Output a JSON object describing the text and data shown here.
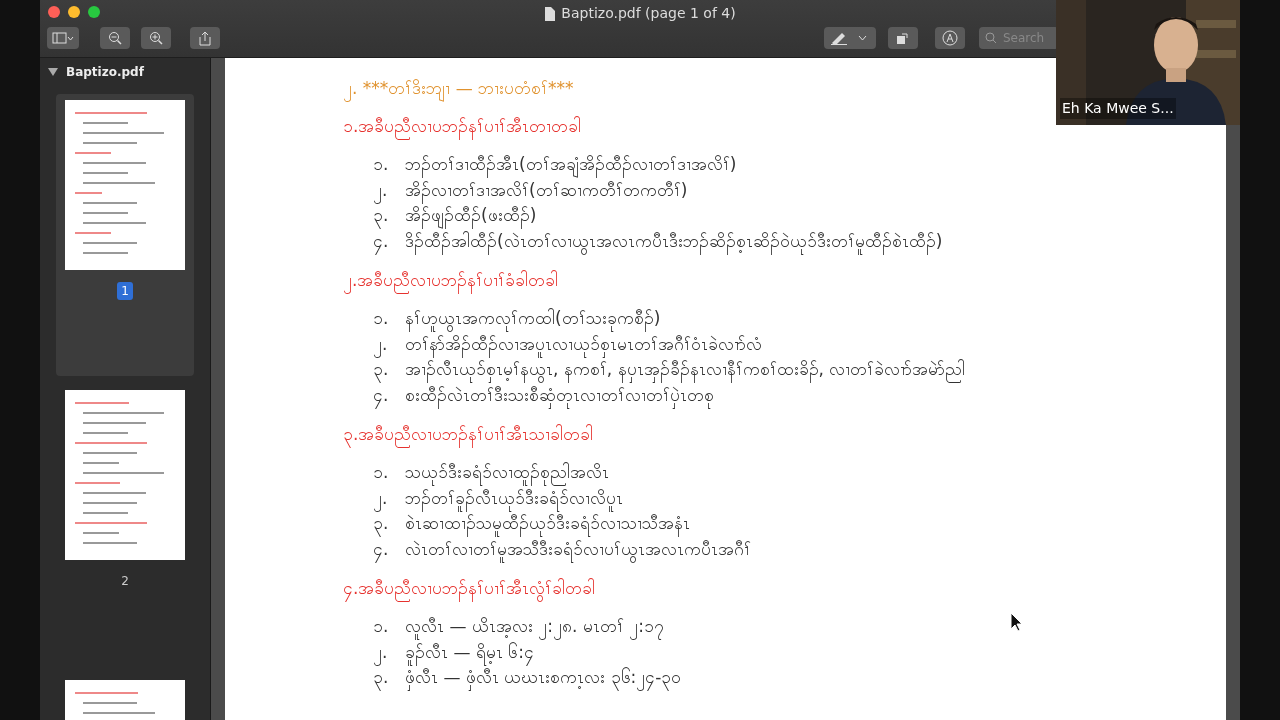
{
  "window": {
    "title": "Baptizo.pdf (page 1 of 4)"
  },
  "toolbar": {
    "search": {
      "placeholder": "Search"
    }
  },
  "sidebar": {
    "file": "Baptizo.pdf",
    "expanded": true,
    "pages": [
      {
        "label": "1",
        "selected": true
      },
      {
        "label": "2",
        "selected": false
      },
      {
        "selected": false
      }
    ]
  },
  "document": {
    "title": "၂. ***တၢ်ဒိးဘျၢ — ဘၢးပတံစၢ်***",
    "sections": [
      {
        "heading": "၁.အခီပညီလၢပဘၣ်နၢ်ပၢၢ်အီၤတၢတခါ",
        "items": [
          {
            "number": "၁.",
            "text": "ဘၣ်တၢ်ဒၢထီၣ်အီၤ(တၢ်အချံအိၣ်ထီၣ်လၢတၢ်ဒၢအလိၢ်)"
          },
          {
            "number": "၂.",
            "text": "အိၣ်လၢတၢ်ဒၢအလိၢ်(တၢ်ဆၢကတီၢ်တကတီၢ်)"
          },
          {
            "number": "၃.",
            "text": "အိၣ်ဖျၣ်ထီၣ်(ဖးထီၣ်)"
          },
          {
            "number": "၄.",
            "text": "ဒိၣ်ထီၣ်အါထီၣ်(လဲၤတၢ်လၢယွၤအလၤကပီၤဒီးဘၣ်ဆိၣ်စ့ၤဆိၣ်ဝဲယုၥ်ဒီးတၢ်မူထီၣ်စဲၤထီၣ်)"
          }
        ]
      },
      {
        "heading": "၂.အခီပညီလၢပဘၣ်နၢ်ပၢၢ်ခံခါတခါ",
        "items": [
          {
            "number": "၁.",
            "text": "နၢ်ဟူယွၤအကလုၢ်ကထါ(တၢ်သးခုကစီၣ်)"
          },
          {
            "number": "၂.",
            "text": "တၢ်နာ်အိၣ်ထီၣ်လၢအပူၤလၢယုၥ်စှၤမၤတၢ်အဂီၢ်ဝံၤခဲလၢာ်လံ"
          },
          {
            "number": "၃.",
            "text": "အၢၣ်လီၤယုၥ်စှၤမ့ၢ်နယွၤ, နကစၢ်, နပှၤအှၣ်ခီၣ်နၤလၢနီၢ်ကစၢ်ထးခိၣ်, လၢတၢ်ခဲလၢာ်အမဲာ်ညါ"
          },
          {
            "number": "၄.",
            "text": "စးထီၣ်လဲၤတၢ်ဒီးသးစီဆှံတုၤလၢတၢ်လၢတၢ်ပှဲၤတစု"
          }
        ]
      },
      {
        "heading": "၃.အခီပညီလၢပဘၣ်နၢ်ပၢၢ်အီၤသၢခါတခါ",
        "items": [
          {
            "number": "၁.",
            "text": "သယုၥ်ဒီးခရံၥ်လၢထူၣ်စုညါအလိၤ"
          },
          {
            "number": "၂.",
            "text": "ဘၣ်တၢ်ခူၣ်လီၤယုၥ်ဒီးခရံၥ်လၢလိပူၤ"
          },
          {
            "number": "၃.",
            "text": "စဲၤဆၢထၢၣ်သမူထီၣ်ယုၥ်ဒီးခရံၥ်လၢသၢသီအနံၤ"
          },
          {
            "number": "၄.",
            "text": "လဲၤတၢ်လၢတၢ်မူအသီဒီးခရံၥ်လၢပၢ်ယွၤအလၤကပီၤအဂီၢ်"
          }
        ]
      },
      {
        "heading": "၄.အခီပညီလၢပဘၣ်နၢ်ပၢၢ်အီၤလွံၢ်ခါတခါ",
        "items": [
          {
            "number": "၁.",
            "text": "လူလီၤ — ယိၤအ့လး ၂:၂၈. မၤတၢ် ၂:၁၇"
          },
          {
            "number": "၂.",
            "text": "ခူၣ်လီၤ — ရိမ့ၤ ၆:၄"
          },
          {
            "number": "၃.",
            "text": "ဖှံလီၤ — ဖှံလီၤ ယဃၤးစကၤ့လး ၃၆:၂၄-၃၀"
          }
        ]
      }
    ]
  },
  "video": {
    "name": "Eh Ka Mwee S..."
  }
}
